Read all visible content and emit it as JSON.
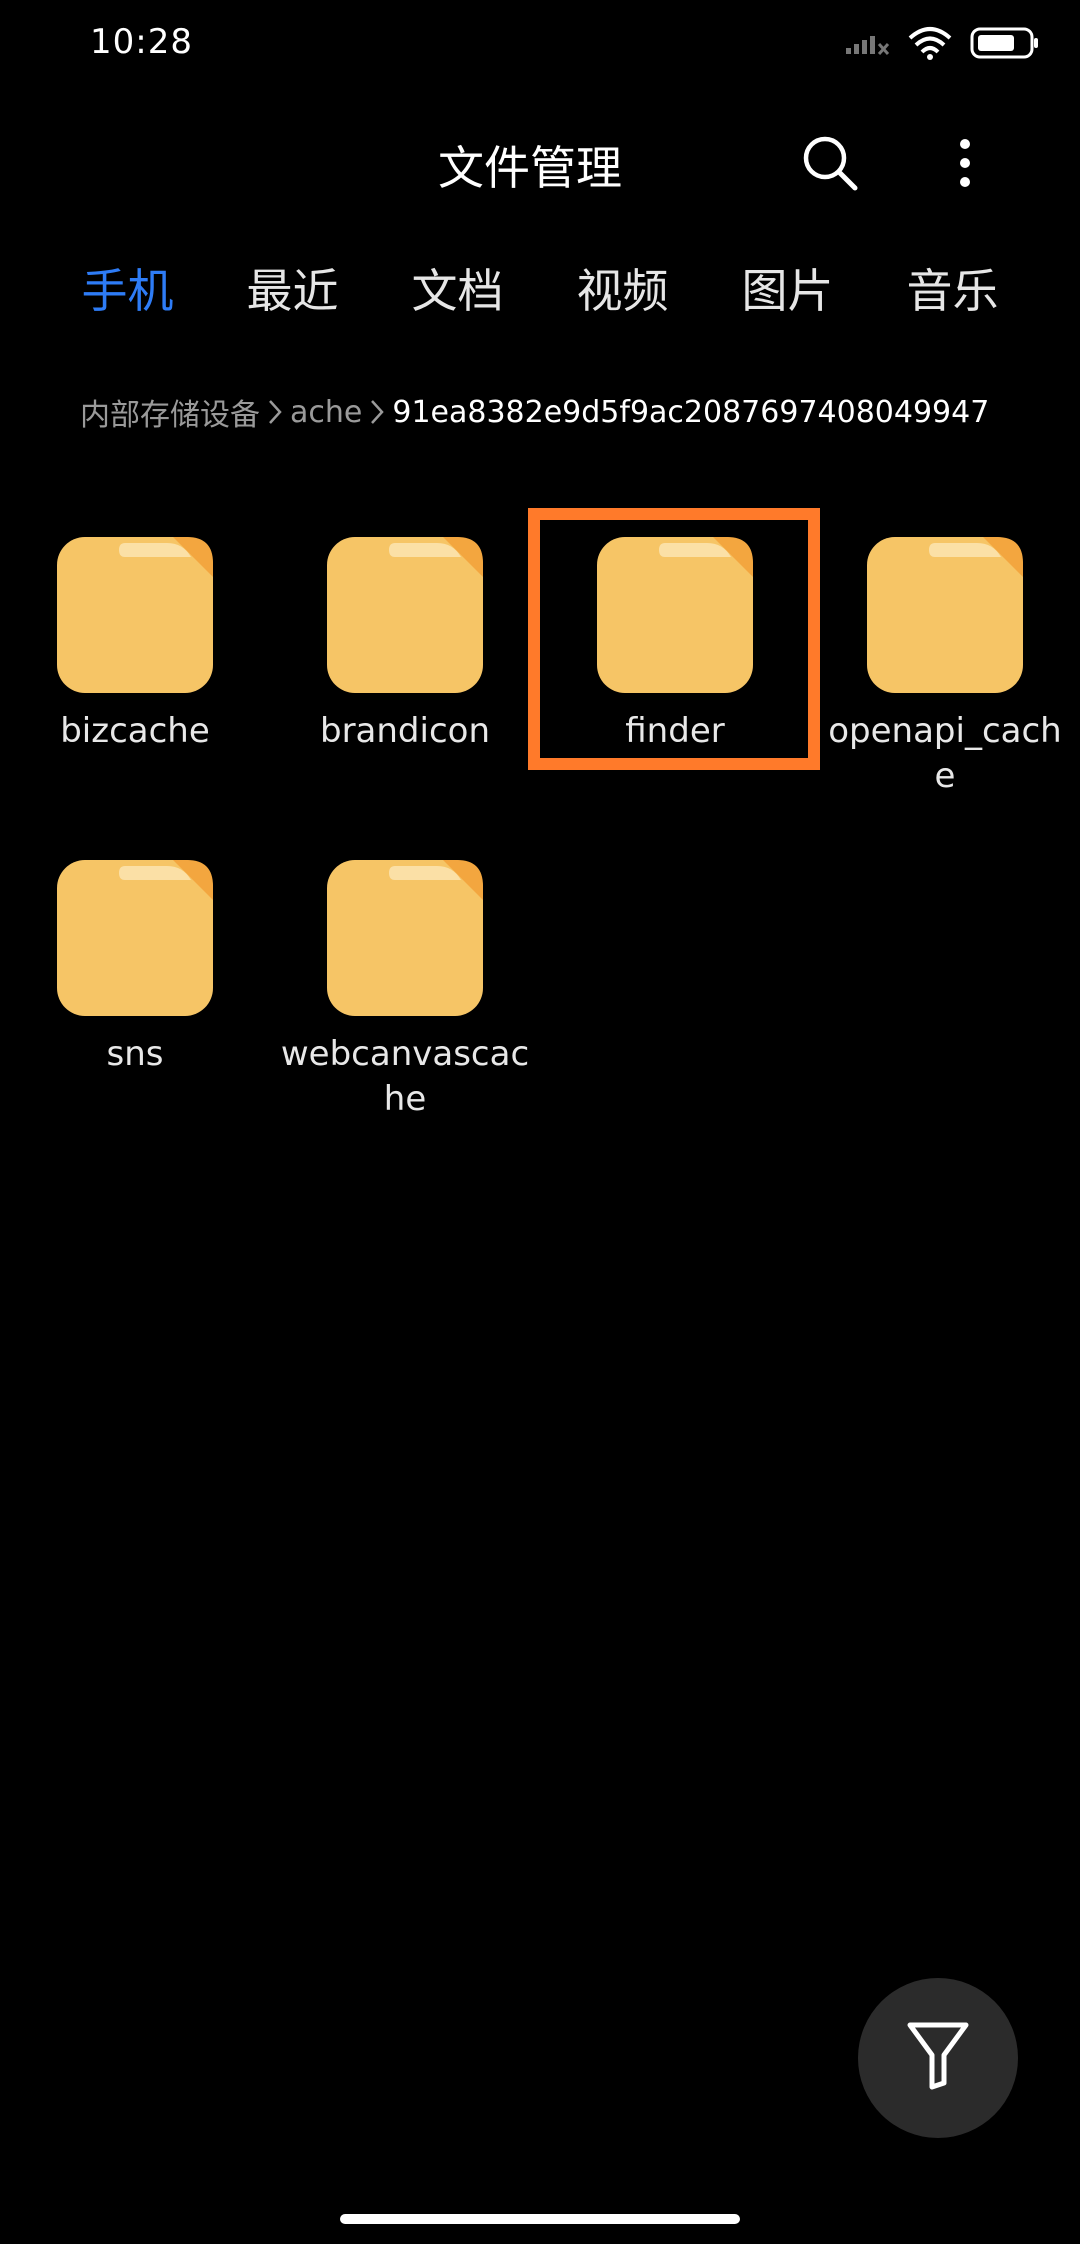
{
  "status_bar": {
    "time": "10:28",
    "icons": [
      "signal-icon",
      "wifi-icon",
      "battery-icon"
    ]
  },
  "header": {
    "title": "文件管理",
    "icons": [
      "search-icon",
      "more-vertical-icon"
    ]
  },
  "tabs": [
    {
      "label": "手机",
      "active": true
    },
    {
      "label": "最近",
      "active": false
    },
    {
      "label": "文档",
      "active": false
    },
    {
      "label": "视频",
      "active": false
    },
    {
      "label": "图片",
      "active": false
    },
    {
      "label": "音乐",
      "active": false
    }
  ],
  "breadcrumb": [
    "内部存储设备",
    "ache",
    "91ea8382e9d5f9ac2087697408049947"
  ],
  "folders": [
    {
      "name": "bizcache"
    },
    {
      "name": "brandicon"
    },
    {
      "name": "finder"
    },
    {
      "name": "openapi_cache"
    },
    {
      "name": "sns"
    },
    {
      "name": "webcanvascache"
    }
  ],
  "fab": {
    "icon": "filter-icon"
  },
  "colors": {
    "accent": "#2e7cf6",
    "folder": "#f6c566",
    "highlight": "#ff7a2a",
    "background": "#000000"
  }
}
